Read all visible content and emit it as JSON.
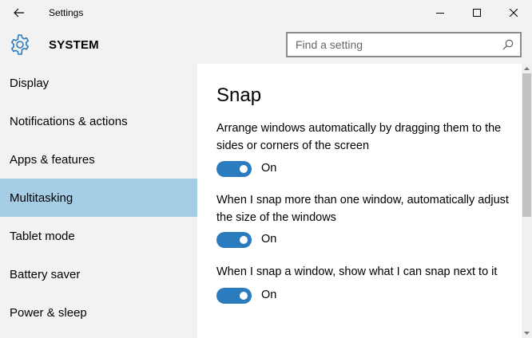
{
  "window": {
    "title": "Settings",
    "back_icon": "back-arrow-icon",
    "controls": [
      "minimize-icon",
      "maximize-icon",
      "close-icon"
    ]
  },
  "header": {
    "section": "SYSTEM",
    "icon": "gear-icon",
    "search": {
      "placeholder": "Find a setting",
      "value": ""
    }
  },
  "sidebar": {
    "items": [
      {
        "label": "Display"
      },
      {
        "label": "Notifications & actions"
      },
      {
        "label": "Apps & features"
      },
      {
        "label": "Multitasking",
        "selected": true
      },
      {
        "label": "Tablet mode"
      },
      {
        "label": "Battery saver"
      },
      {
        "label": "Power & sleep"
      }
    ]
  },
  "main": {
    "title": "Snap",
    "settings": [
      {
        "description": "Arrange windows automatically by dragging them to the sides or corners of the screen",
        "state": "On"
      },
      {
        "description": "When I snap more than one window, automatically adjust the size of the windows",
        "state": "On"
      },
      {
        "description": "When I snap a window, show what I can snap next to it",
        "state": "On"
      }
    ]
  },
  "colors": {
    "accent": "#2b7bbf",
    "selected_nav": "#a6cde6",
    "chrome": "#f2f2f2"
  }
}
